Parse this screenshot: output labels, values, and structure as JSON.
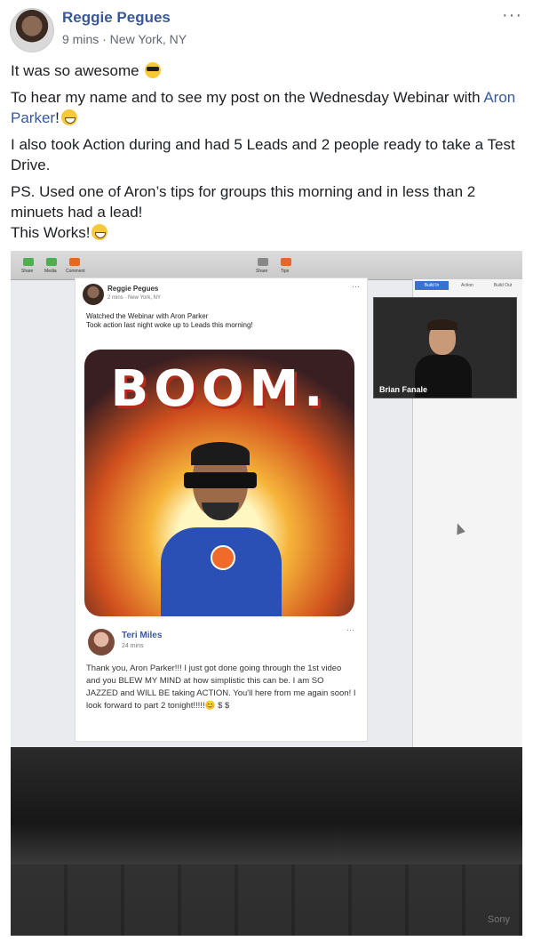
{
  "post": {
    "author": "Reggie Pegues",
    "meta": "9 mins · New York, NY",
    "more": "···",
    "paragraphs": {
      "p1": "It was so awesome",
      "p2_a": "To hear my name and to see my post on the Wednesday Webinar with",
      "p2_mention": "Aron Parker",
      "p2_end": "!",
      "p3": "I also took Action during and had 5 Leads and 2 people ready to take a Test Drive.",
      "p4": "PS. Used one of Aron’s tips for groups this morning and in less than 2 minuets had a lead!",
      "p5": "This Works!"
    }
  },
  "photo": {
    "toolbar_labels": [
      "Share",
      "Media",
      "Comment",
      "Share",
      "Tips"
    ],
    "right_tabs": [
      "Build In",
      "Action",
      "Build Out"
    ],
    "inner_post": {
      "author": "Reggie Pegues",
      "meta": "2 mins · New York, NY",
      "line1": "Watched the Webinar with Aron Parker",
      "line2": "Took action last night woke up to Leads this morning!",
      "more": "···",
      "sticker_word": "BOOM."
    },
    "comment": {
      "author": "Teri Miles",
      "meta": "24 mins",
      "more": "···",
      "text": "Thank you, Aron Parker!!! I just got done going through the 1st video and you BLEW MY MIND at how simplistic this can be. I am SO JAZZED and WILL BE taking ACTION. You'll here from me again soon! I look forward to part 2 tonight!!!!!😊 $ $"
    },
    "video": {
      "name": "Brian Fanale"
    },
    "brand": "Sony"
  },
  "colors": {
    "link": "#385898",
    "meta": "#616770"
  }
}
